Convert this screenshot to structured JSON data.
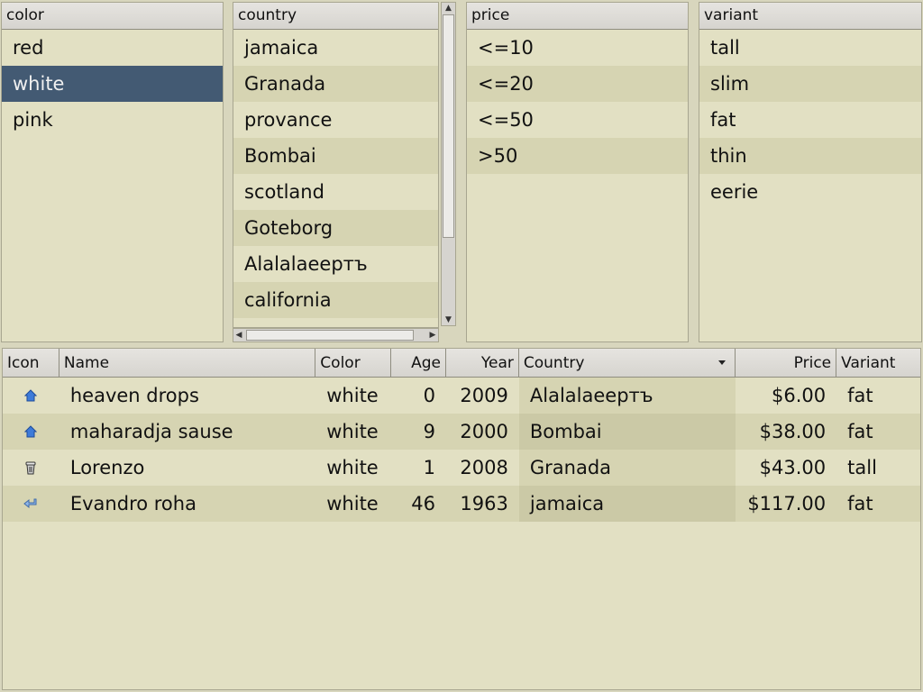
{
  "panes": {
    "color": {
      "header": "color",
      "items": [
        "red",
        "white",
        "pink"
      ],
      "selected": 1
    },
    "country": {
      "header": "country",
      "items": [
        "jamaica",
        "Granada",
        "provance",
        "Bombai",
        "scotland",
        "Goteborg",
        "Alalalaeертъ",
        "california"
      ]
    },
    "price": {
      "header": "price",
      "items": [
        "<=10",
        "<=20",
        "<=50",
        ">50"
      ]
    },
    "variant": {
      "header": "variant",
      "items": [
        "tall",
        "slim",
        "fat",
        "thin",
        "eerie"
      ]
    }
  },
  "table": {
    "columns": {
      "icon": "Icon",
      "name": "Name",
      "color": "Color",
      "age": "Age",
      "year": "Year",
      "country": "Country",
      "price": "Price",
      "variant": "Variant"
    },
    "sorted_column": "country",
    "rows": [
      {
        "icon": "house-icon",
        "name": "heaven drops",
        "color": "white",
        "age": "0",
        "year": "2009",
        "country": "Alalalaeертъ",
        "price": "$6.00",
        "variant": "fat"
      },
      {
        "icon": "house-icon",
        "name": "maharadja sause",
        "color": "white",
        "age": "9",
        "year": "2000",
        "country": "Bombai",
        "price": "$38.00",
        "variant": "fat"
      },
      {
        "icon": "trash-can-icon",
        "name": "Lorenzo",
        "color": "white",
        "age": "1",
        "year": "2008",
        "country": "Granada",
        "price": "$43.00",
        "variant": "tall"
      },
      {
        "icon": "return-arrow-icon",
        "name": "Evandro roha",
        "color": "white",
        "age": "46",
        "year": "1963",
        "country": "jamaica",
        "price": "$117.00",
        "variant": "fat"
      }
    ]
  },
  "colors": {
    "background": "#e2e0c3",
    "alt_row": "#d6d4b2",
    "selection": "#435a73"
  }
}
